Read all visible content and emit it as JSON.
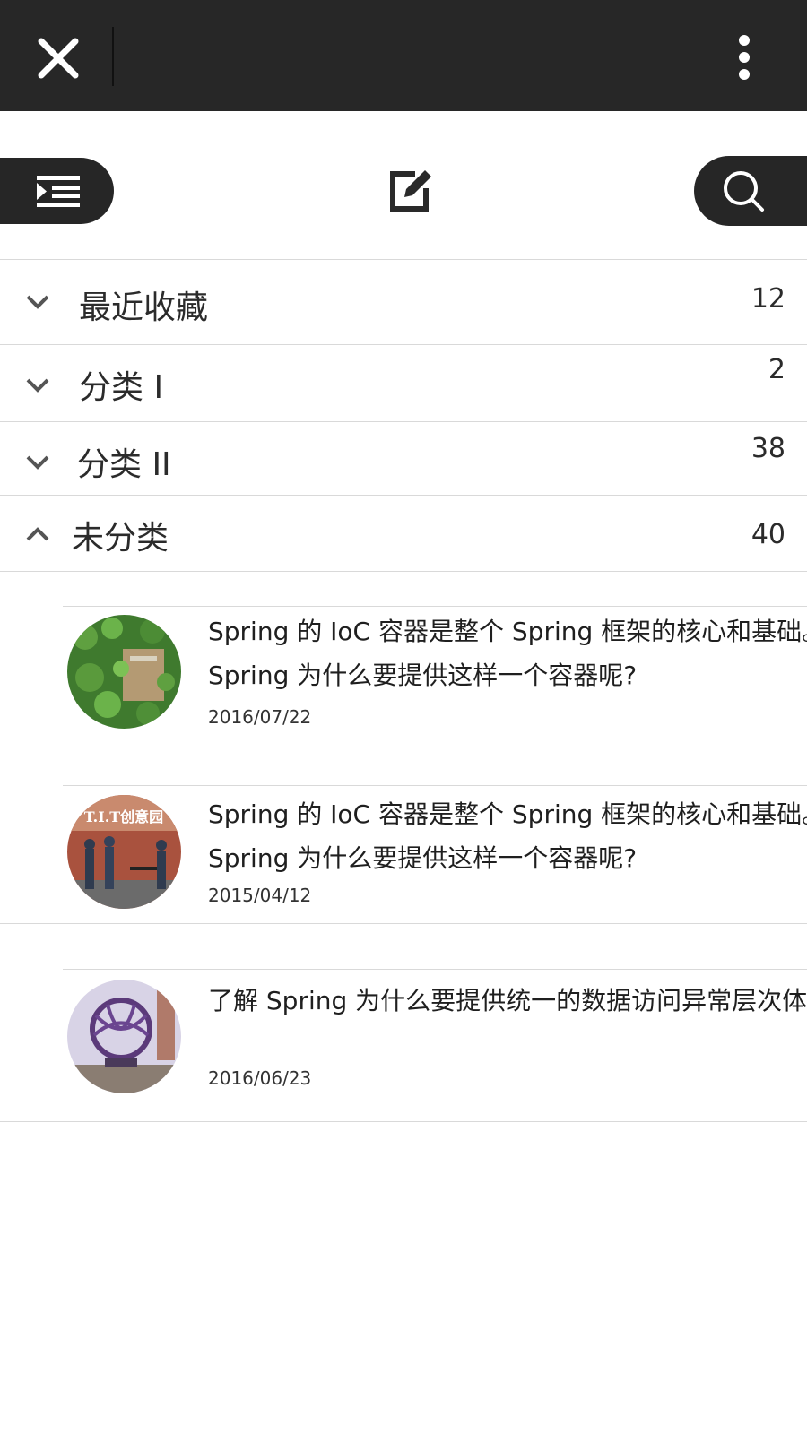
{
  "titlebar": {
    "close_icon": "close-icon",
    "more_icon": "more-vertical-icon"
  },
  "toolbar": {
    "menu_icon": "indent-list-icon",
    "compose_icon": "edit-icon",
    "search_icon": "search-icon"
  },
  "categories": [
    {
      "label": "最近收藏",
      "count": "12",
      "expanded": false
    },
    {
      "label": "分类 I",
      "count": "2",
      "expanded": false
    },
    {
      "label": "分类 II",
      "count": "38",
      "expanded": false
    },
    {
      "label": "未分类",
      "count": "40",
      "expanded": true
    }
  ],
  "articles": [
    {
      "line1": "Spring 的 IoC 容器是整个 Spring 框架的核心和基础。",
      "line2": "Spring 为什么要提供这样一个容器呢?",
      "date": "2016/07/22"
    },
    {
      "line1": "Spring 的 IoC 容器是整个 Spring 框架的核心和基础。",
      "line2": "Spring 为什么要提供这样一个容器呢?",
      "date": "2015/04/12",
      "image_text": "T.I.T创意园"
    },
    {
      "line1": "了解 Spring 为什么要提供统一的数据访问异常层次体系",
      "line2": "",
      "date": "2016/06/23"
    }
  ],
  "colors": {
    "bar": "#272727",
    "divider": "#d9d9d9",
    "text": "#2b2b2b"
  }
}
